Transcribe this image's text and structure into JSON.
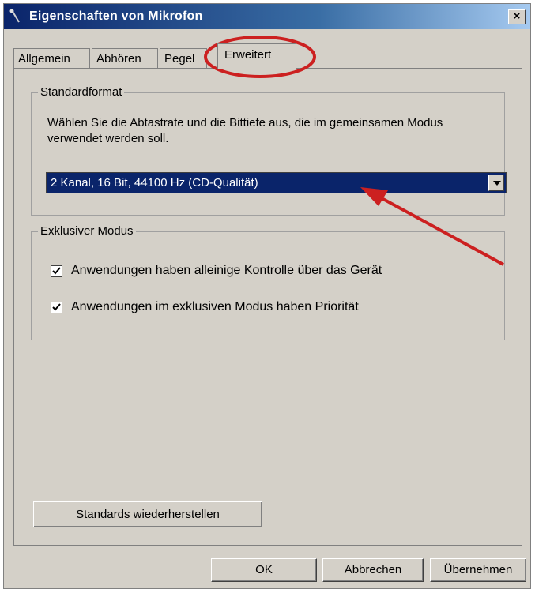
{
  "window": {
    "title": "Eigenschaften von Mikrofon",
    "close_label": "×"
  },
  "tabs": [
    {
      "label": "Allgemein",
      "active": false
    },
    {
      "label": "Abhören",
      "active": false
    },
    {
      "label": "Pegel",
      "active": false
    },
    {
      "label": "Erweitert",
      "active": true
    }
  ],
  "standardformat": {
    "legend": "Standardformat",
    "description": "Wählen Sie die Abtastrate und die Bittiefe aus, die im gemeinsamen Modus verwendet werden soll.",
    "selected_format": "2 Kanal, 16 Bit, 44100 Hz (CD-Qualität)"
  },
  "exclusive": {
    "legend": "Exklusiver Modus",
    "options": [
      {
        "label": "Anwendungen haben alleinige Kontrolle über das Gerät",
        "checked": true
      },
      {
        "label": "Anwendungen im exklusiven Modus haben Priorität",
        "checked": true
      }
    ]
  },
  "restore_button": "Standards wiederherstellen",
  "footer": {
    "ok": "OK",
    "cancel": "Abbrechen",
    "apply": "Übernehmen"
  },
  "colors": {
    "titlebar": "#0a246a",
    "selection": "#0a246a",
    "annotation": "#cc2020"
  }
}
